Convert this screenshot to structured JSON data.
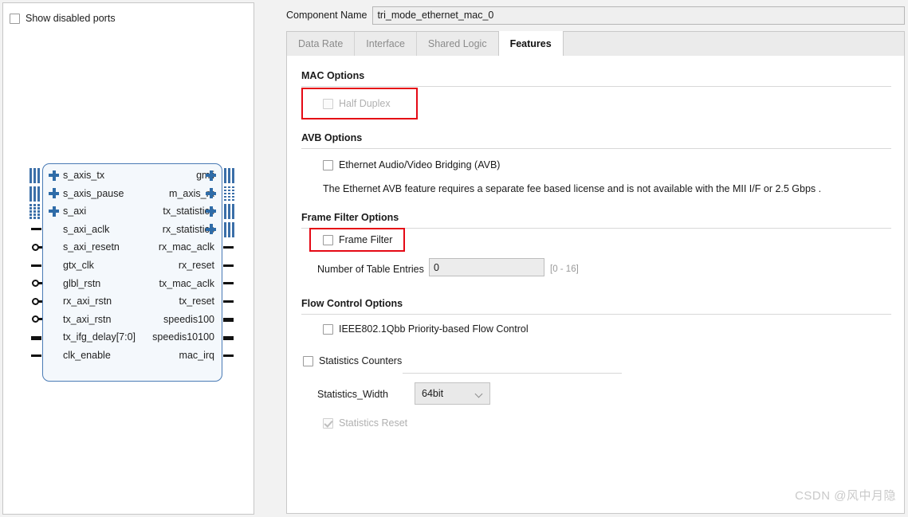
{
  "left_panel": {
    "show_disabled_ports": {
      "label": "Show disabled ports",
      "checked": false
    },
    "symbol": {
      "left_pins": [
        {
          "name": "s_axis_tx",
          "type": "bus-plus"
        },
        {
          "name": "s_axis_pause",
          "type": "bus-plus"
        },
        {
          "name": "s_axi",
          "type": "bus-plus"
        },
        {
          "name": "s_axi_aclk",
          "type": "stub"
        },
        {
          "name": "s_axi_resetn",
          "type": "inverted"
        },
        {
          "name": "gtx_clk",
          "type": "stub"
        },
        {
          "name": "glbl_rstn",
          "type": "inverted"
        },
        {
          "name": "rx_axi_rstn",
          "type": "inverted"
        },
        {
          "name": "tx_axi_rstn",
          "type": "inverted"
        },
        {
          "name": "tx_ifg_delay[7:0]",
          "type": "bus-stub"
        },
        {
          "name": "clk_enable",
          "type": "stub"
        }
      ],
      "right_pins": [
        {
          "name": "gmii",
          "type": "bus-plus"
        },
        {
          "name": "m_axis_rx",
          "type": "bus-plus"
        },
        {
          "name": "tx_statistics",
          "type": "bus-plus"
        },
        {
          "name": "rx_statistics",
          "type": "bus-plus"
        },
        {
          "name": "rx_mac_aclk",
          "type": "stub"
        },
        {
          "name": "rx_reset",
          "type": "stub"
        },
        {
          "name": "tx_mac_aclk",
          "type": "stub"
        },
        {
          "name": "tx_reset",
          "type": "stub"
        },
        {
          "name": "speedis100",
          "type": "bus-stub"
        },
        {
          "name": "speedis10100",
          "type": "bus-stub"
        },
        {
          "name": "mac_irq",
          "type": "stub"
        }
      ]
    }
  },
  "header": {
    "component_name_label": "Component Name",
    "component_name_value": "tri_mode_ethernet_mac_0"
  },
  "tabs": [
    {
      "label": "Data Rate",
      "active": false
    },
    {
      "label": "Interface",
      "active": false
    },
    {
      "label": "Shared Logic",
      "active": false
    },
    {
      "label": "Features",
      "active": true
    }
  ],
  "features": {
    "mac_options": {
      "title": "MAC Options",
      "half_duplex": {
        "label": "Half Duplex",
        "checked": false,
        "disabled": true,
        "highlighted": true
      }
    },
    "avb_options": {
      "title": "AVB Options",
      "avb_checkbox": {
        "label": "Ethernet Audio/Video Bridging (AVB)",
        "checked": false
      },
      "note": "The Ethernet AVB feature requires a separate fee based license and is not available with the MII I/F or 2.5 Gbps ."
    },
    "frame_filter_options": {
      "title": "Frame Filter Options",
      "frame_filter": {
        "label": "Frame Filter",
        "checked": false,
        "highlighted": true
      },
      "table_entries": {
        "label": "Number of Table Entries",
        "value": "0",
        "range_hint": "[0 - 16]"
      }
    },
    "flow_control_options": {
      "title": "Flow Control Options",
      "pfc": {
        "label": "IEEE802.1Qbb Priority-based Flow Control",
        "checked": false
      },
      "statistics_counters": {
        "label": "Statistics Counters",
        "checked": false
      },
      "statistics_width": {
        "label": "Statistics_Width",
        "value": "64bit"
      },
      "statistics_reset": {
        "label": "Statistics Reset",
        "checked": true,
        "disabled": true
      }
    }
  },
  "watermark": "CSDN @风中月隐",
  "colors": {
    "highlight_red": "#e50915",
    "symbol_border": "#4a7bb5",
    "symbol_fill": "#f4f8fc",
    "bus_blue": "#3b6fa8"
  }
}
